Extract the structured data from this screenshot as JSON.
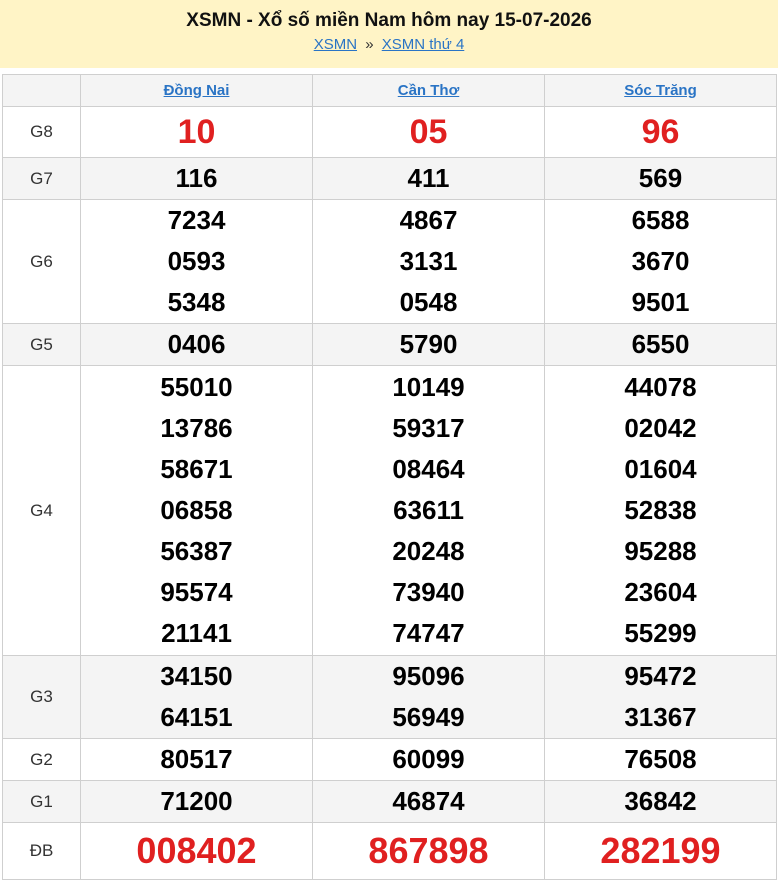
{
  "header": {
    "title": "XSMN - Xổ số miền Nam hôm nay 15-07-2026",
    "breadcrumb": [
      "XSMN",
      "XSMN thứ 4"
    ],
    "separator": "»"
  },
  "provinces": [
    "Đồng Nai",
    "Cần Thơ",
    "Sóc Trăng"
  ],
  "rows": [
    {
      "label": "G8",
      "values": [
        [
          "10"
        ],
        [
          "05"
        ],
        [
          "96"
        ]
      ]
    },
    {
      "label": "G7",
      "values": [
        [
          "116"
        ],
        [
          "411"
        ],
        [
          "569"
        ]
      ]
    },
    {
      "label": "G6",
      "values": [
        [
          "7234",
          "0593",
          "5348"
        ],
        [
          "4867",
          "3131",
          "0548"
        ],
        [
          "6588",
          "3670",
          "9501"
        ]
      ]
    },
    {
      "label": "G5",
      "values": [
        [
          "0406"
        ],
        [
          "5790"
        ],
        [
          "6550"
        ]
      ]
    },
    {
      "label": "G4",
      "values": [
        [
          "55010",
          "13786",
          "58671",
          "06858",
          "56387",
          "95574",
          "21141"
        ],
        [
          "10149",
          "59317",
          "08464",
          "63611",
          "20248",
          "73940",
          "74747"
        ],
        [
          "44078",
          "02042",
          "01604",
          "52838",
          "95288",
          "23604",
          "55299"
        ]
      ]
    },
    {
      "label": "G3",
      "values": [
        [
          "34150",
          "64151"
        ],
        [
          "95096",
          "56949"
        ],
        [
          "95472",
          "31367"
        ]
      ]
    },
    {
      "label": "G2",
      "values": [
        [
          "80517"
        ],
        [
          "60099"
        ],
        [
          "76508"
        ]
      ]
    },
    {
      "label": "G1",
      "values": [
        [
          "71200"
        ],
        [
          "46874"
        ],
        [
          "36842"
        ]
      ]
    },
    {
      "label": "ĐB",
      "values": [
        [
          "008402"
        ],
        [
          "867898"
        ],
        [
          "282199"
        ]
      ]
    }
  ],
  "colors": {
    "accent_red": "#e02020",
    "link_blue": "#2a74c5",
    "header_bg": "#fff4c6"
  }
}
